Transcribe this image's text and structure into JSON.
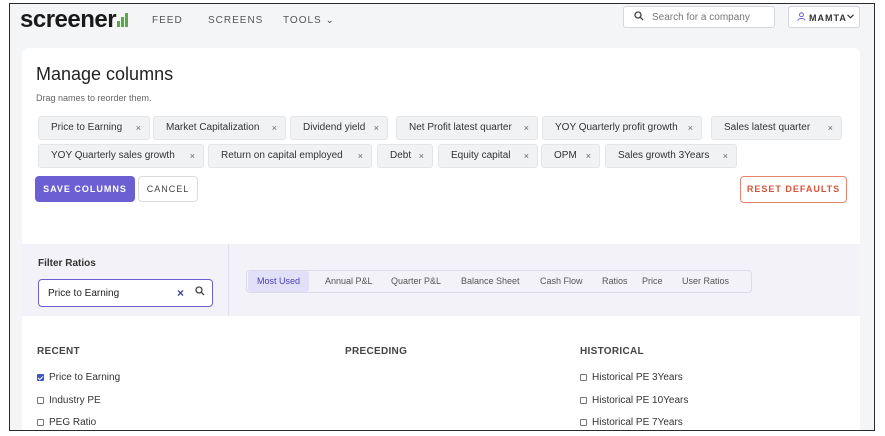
{
  "nav": {
    "logo": "screener",
    "links": [
      "FEED",
      "SCREENS",
      "TOOLS"
    ],
    "tools_chevron": "⌄",
    "search_placeholder": "Search for a company",
    "user": "MAMTA"
  },
  "manage": {
    "title": "Manage columns",
    "subtitle": "Drag names to reorder them.",
    "chips_row1": [
      "Price to Earning",
      "Market Capitalization",
      "Dividend yield",
      "Net Profit latest quarter",
      "YOY Quarterly profit growth",
      "Sales latest quarter"
    ],
    "chips_row2": [
      "YOY Quarterly sales growth",
      "Return on capital employed",
      "Debt",
      "Equity capital",
      "OPM",
      "Sales growth 3Years"
    ],
    "chip_remove": "×",
    "save": "SAVE COLUMNS",
    "cancel": "CANCEL",
    "reset": "RESET DEFAULTS"
  },
  "filter": {
    "title": "Filter Ratios",
    "value": "Price to Earning",
    "clear": "×",
    "tabs": [
      "Most Used",
      "Annual P&L",
      "Quarter P&L",
      "Balance Sheet",
      "Cash Flow",
      "Ratios",
      "Price",
      "User Ratios"
    ],
    "active_tab": "Most Used"
  },
  "columns": {
    "recent": {
      "heading": "RECENT",
      "items": [
        {
          "label": "Price to Earning",
          "checked": true
        },
        {
          "label": "Industry PE",
          "checked": false
        },
        {
          "label": "PEG Ratio",
          "checked": false
        }
      ]
    },
    "preceding": {
      "heading": "PRECEDING",
      "items": []
    },
    "historical": {
      "heading": "HISTORICAL",
      "items": [
        {
          "label": "Historical PE 3Years",
          "checked": false
        },
        {
          "label": "Historical PE 10Years",
          "checked": false
        },
        {
          "label": "Historical PE 7Years",
          "checked": false
        }
      ]
    }
  },
  "colors": {
    "accent": "#6b5fd3",
    "reset": "#d4553b",
    "logo_bars": "#5aa846"
  }
}
